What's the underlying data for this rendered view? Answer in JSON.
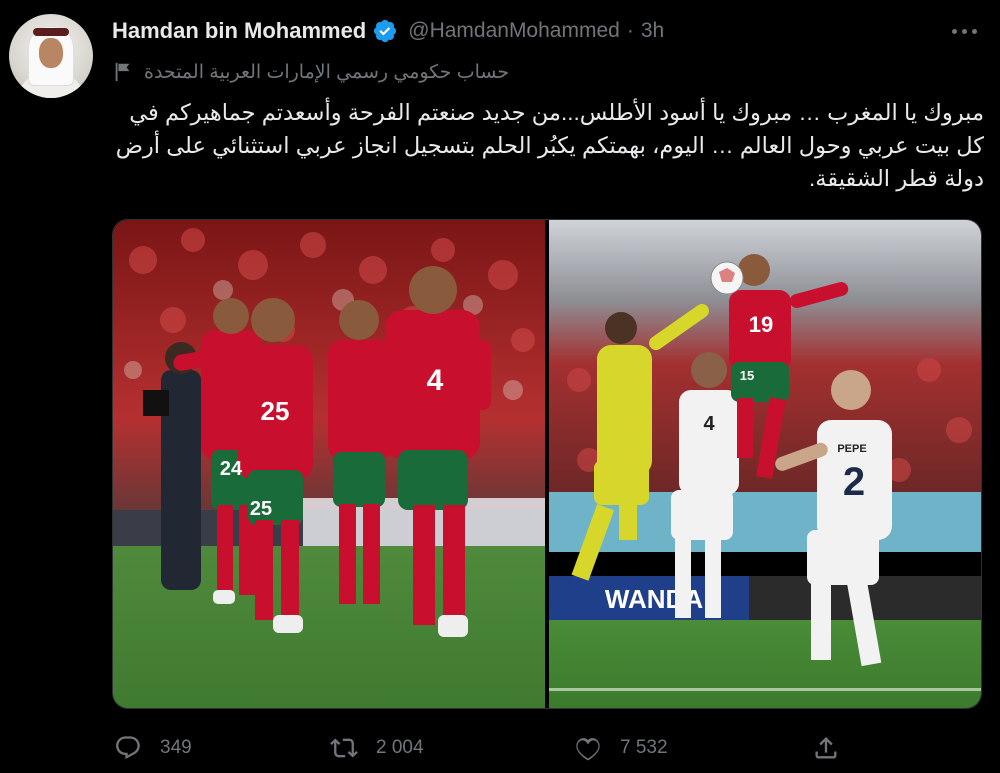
{
  "author": {
    "name": "Hamdan bin Mohammed",
    "handle": "@HamdanMohammed",
    "separator": "·",
    "time": "3h",
    "label": "حساب حكومي رسمي الإمارات العربية المتحدة"
  },
  "tweet": {
    "text": "مبروك يا المغرب … مبروك يا أسود الأطلس...من جديد صنعتم الفرحة وأسعدتم جماهيركم في كل بيت عربي وحول العالم … اليوم، بهمتكم يكبُر الحلم بتسجيل انجاز عربي استثنائي على أرض دولة قطر الشقيقة."
  },
  "media": {
    "left_photo": {
      "player_numbers": [
        "25",
        "4",
        "24",
        "25"
      ]
    },
    "right_photo": {
      "player_numbers": [
        "19",
        "4",
        "2",
        "15"
      ],
      "shirt_name": "PEPE",
      "ad_board": "WANDA"
    }
  },
  "actions": {
    "replies": "349",
    "retweets": "2 004",
    "likes": "7 532"
  },
  "icons": {
    "verified": "verified-badge-icon",
    "more": "more-options-icon",
    "label": "government-flag-icon",
    "reply": "reply-icon",
    "retweet": "retweet-icon",
    "like": "like-icon",
    "share": "share-icon"
  },
  "colors": {
    "background": "#000000",
    "text_primary": "#e7e9ea",
    "text_secondary": "#71767b",
    "verified_blue": "#1d9bf0",
    "morocco_red": "#c8102e",
    "morocco_green": "#1a6b3a"
  }
}
